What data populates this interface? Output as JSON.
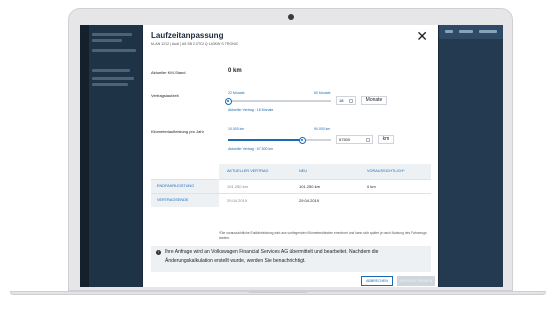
{
  "modal": {
    "title": "Laufzeitanpassung",
    "subtitle": "M-AN 1212 | Audi | A5 SB 2.0TDI Q 140KW S TRONIC",
    "close_label": "✕"
  },
  "km_stand": {
    "label": "Aktueller KM-Stand",
    "value": "0 km"
  },
  "laufzeit": {
    "label": "Vertragslaufzeit",
    "min_label": "22 Monate",
    "max_label": "60 Monate",
    "current_label": "Aktueller Vertrag : 18 Monate",
    "input_value": "18",
    "unit": "Monate",
    "slider_fraction": 0.0
  },
  "km_leistung": {
    "label": "Kilometerlaufleistung pro Jahr",
    "min_label": "10.000 km",
    "max_label": "90.000 km",
    "current_label": "Aktueller Vertrag : 67.500 km",
    "input_value": "67500",
    "unit": "km",
    "slider_fraction": 0.72
  },
  "table": {
    "headers": [
      "AKTUELLER VERTRAG",
      "NEU",
      "VORAUSSICHTLICH*"
    ],
    "rows": [
      {
        "label": "ENDFAHRLEISTUNG",
        "current": "101.250 km",
        "new": "101.250 km",
        "expected": "0 km"
      },
      {
        "label": "VERTRAGSENDE",
        "current": "29.04.2019",
        "new": "29.04.2019",
        "expected": ""
      }
    ]
  },
  "footnote": "*Die voraussichtliche Endfahrleistung wird aus vorliegenden Kilometerständen errechnet und kann sich später je nach Nutzung des Fahrzeugs ändern.",
  "info": {
    "icon": "info-icon",
    "text": "Ihre Anfrage wird an Volkswagen Financial Services AG übermittelt und bearbeitet. Nachdem die Änderungskalkulation erstellt wurde, werden Sie benachrichtigt."
  },
  "buttons": {
    "cancel": "ABBRECHEN",
    "send": "ANFRAGE SENDEN"
  },
  "colors": {
    "accent": "#1a6bb5",
    "panel": "#eef1f4",
    "background": "#1b2a3a"
  }
}
